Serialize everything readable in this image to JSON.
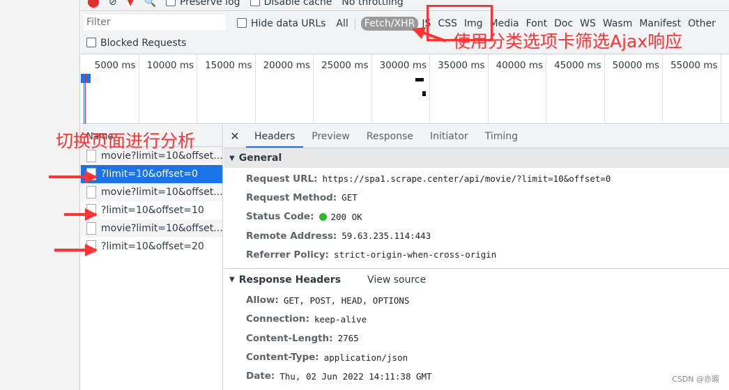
{
  "toolbar": {
    "preserve_log": "Preserve log",
    "disable_cache": "Disable cache",
    "throttling": "No throttling"
  },
  "filter": {
    "placeholder": "Filter",
    "hide_data_urls": "Hide data URLs",
    "blocked_requests": "Blocked Requests",
    "types": [
      "All",
      "Fetch/XHR",
      "JS",
      "CSS",
      "Img",
      "Media",
      "Font",
      "Doc",
      "WS",
      "Wasm",
      "Manifest",
      "Other"
    ],
    "active_type": "Fetch/XHR"
  },
  "timeline": {
    "ticks": [
      "5000 ms",
      "10000 ms",
      "15000 ms",
      "20000 ms",
      "25000 ms",
      "30000 ms",
      "35000 ms",
      "40000 ms",
      "45000 ms",
      "50000 ms",
      "55000 ms"
    ]
  },
  "requests": {
    "header": "Name",
    "items": [
      "movie?limit=10&offset...",
      "?limit=10&offset=0",
      "movie?limit=10&offset...",
      "?limit=10&offset=10",
      "movie?limit=10&offset...",
      "?limit=10&offset=20"
    ],
    "selected": 1
  },
  "details": {
    "tabs": [
      "Headers",
      "Preview",
      "Response",
      "Initiator",
      "Timing"
    ],
    "active_tab": "Headers",
    "general_title": "General",
    "general": [
      [
        "Request URL:",
        "https://spa1.scrape.center/api/movie/?limit=10&offset=0"
      ],
      [
        "Request Method:",
        "GET"
      ],
      [
        "Status Code:",
        "200 OK"
      ],
      [
        "Remote Address:",
        "59.63.235.114:443"
      ],
      [
        "Referrer Policy:",
        "strict-origin-when-cross-origin"
      ]
    ],
    "response_title": "Response Headers",
    "view_source": "View source",
    "response": [
      [
        "Allow:",
        "GET, POST, HEAD, OPTIONS"
      ],
      [
        "Connection:",
        "keep-alive"
      ],
      [
        "Content-Length:",
        "2765"
      ],
      [
        "Content-Type:",
        "application/json"
      ],
      [
        "Date:",
        "Thu, 02 Jun 2022 14:11:38 GMT"
      ]
    ]
  },
  "annotations": {
    "filter_note": "使用分类选项卡筛选Ajax响应",
    "switch_note": "切换页面进行分析"
  },
  "watermark": "CSDN @亦瑕",
  "colors": {
    "accent": "#1a73e8",
    "annotation": "#ff3333",
    "status_ok": "#2eb82e"
  }
}
